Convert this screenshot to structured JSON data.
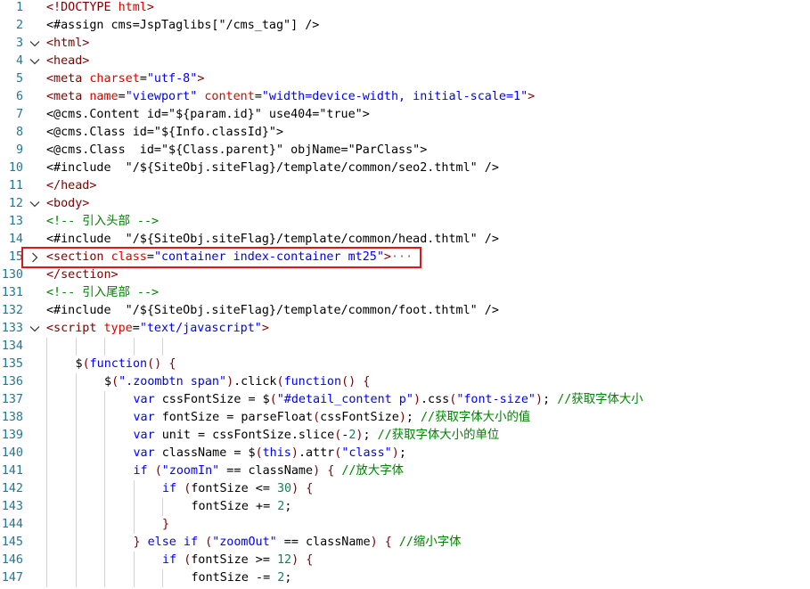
{
  "theme": {
    "line_number": "#237893",
    "tag": "#800000",
    "attr": "#e50000",
    "string": "#0000ff",
    "text": "#000000",
    "comment": "#008000",
    "keyword": "#0000ff",
    "punct": "#800000",
    "number": "#098658",
    "highlight_box": "#e0161a"
  },
  "icons": {
    "fold_open": "chevron-down-icon",
    "fold_closed": "chevron-right-icon"
  },
  "highlighted_line": "15",
  "lines": [
    {
      "num": "1",
      "fold": "",
      "indent": 0,
      "tokens": [
        [
          "tag",
          "<!DOCTYPE "
        ],
        [
          "attr",
          "html"
        ],
        [
          "tag",
          ">"
        ]
      ]
    },
    {
      "num": "2",
      "fold": "",
      "indent": 0,
      "tokens": [
        [
          "text",
          "<#assign cms=JspTaglibs[\"/cms_tag\"] />"
        ]
      ]
    },
    {
      "num": "3",
      "fold": "open",
      "indent": 0,
      "tokens": [
        [
          "tag",
          "<html>"
        ]
      ]
    },
    {
      "num": "4",
      "fold": "open",
      "indent": 0,
      "tokens": [
        [
          "tag",
          "<head>"
        ]
      ]
    },
    {
      "num": "5",
      "fold": "",
      "indent": 0,
      "tokens": [
        [
          "tag",
          "<meta "
        ],
        [
          "attr",
          "charset"
        ],
        [
          "text",
          "="
        ],
        [
          "string",
          "\"utf-8\""
        ],
        [
          "tag",
          ">"
        ]
      ]
    },
    {
      "num": "6",
      "fold": "",
      "indent": 0,
      "tokens": [
        [
          "tag",
          "<meta "
        ],
        [
          "attr",
          "name"
        ],
        [
          "text",
          "="
        ],
        [
          "string",
          "\"viewport\""
        ],
        [
          "text",
          " "
        ],
        [
          "attr",
          "content"
        ],
        [
          "text",
          "="
        ],
        [
          "string",
          "\"width=device-width, initial-scale=1\""
        ],
        [
          "tag",
          ">"
        ]
      ]
    },
    {
      "num": "7",
      "fold": "",
      "indent": 0,
      "tokens": [
        [
          "text",
          "<@cms.Content id=\"${param.id}\" use404=\"true\">"
        ]
      ]
    },
    {
      "num": "8",
      "fold": "",
      "indent": 0,
      "tokens": [
        [
          "text",
          "<@cms.Class id=\"${Info.classId}\">"
        ]
      ]
    },
    {
      "num": "9",
      "fold": "",
      "indent": 0,
      "tokens": [
        [
          "text",
          "<@cms.Class  id=\"${Class.parent}\" objName=\"ParClass\">"
        ]
      ]
    },
    {
      "num": "10",
      "fold": "",
      "indent": 0,
      "tokens": [
        [
          "text",
          "<#include  \"/${SiteObj.siteFlag}/template/common/seo2.thtml\" />"
        ]
      ]
    },
    {
      "num": "11",
      "fold": "",
      "indent": 0,
      "tokens": [
        [
          "tag",
          "</head>"
        ]
      ]
    },
    {
      "num": "12",
      "fold": "open",
      "indent": 0,
      "tokens": [
        [
          "tag",
          "<body>"
        ]
      ]
    },
    {
      "num": "13",
      "fold": "",
      "indent": 0,
      "tokens": [
        [
          "comment",
          "<!-- 引入头部 -->"
        ]
      ]
    },
    {
      "num": "14",
      "fold": "",
      "indent": 0,
      "tokens": [
        [
          "text",
          "<#include  \"/${SiteObj.siteFlag}/template/common/head.thtml\" />"
        ]
      ]
    },
    {
      "num": "15",
      "fold": "closed",
      "indent": 0,
      "tokens": [
        [
          "tag",
          "<section "
        ],
        [
          "attr",
          "class"
        ],
        [
          "text",
          "="
        ],
        [
          "string",
          "\"container index-container mt25\""
        ],
        [
          "tag",
          ">"
        ],
        [
          "ellipsis",
          "···"
        ]
      ]
    },
    {
      "num": "130",
      "fold": "",
      "indent": 0,
      "tokens": [
        [
          "tag",
          "</section>"
        ]
      ]
    },
    {
      "num": "131",
      "fold": "",
      "indent": 0,
      "tokens": [
        [
          "comment",
          "<!-- 引入尾部 -->"
        ]
      ]
    },
    {
      "num": "132",
      "fold": "",
      "indent": 0,
      "tokens": [
        [
          "text",
          "<#include  \"/${SiteObj.siteFlag}/template/common/foot.thtml\" />"
        ]
      ]
    },
    {
      "num": "133",
      "fold": "open",
      "indent": 0,
      "tokens": [
        [
          "tag",
          "<script "
        ],
        [
          "attr",
          "type"
        ],
        [
          "text",
          "="
        ],
        [
          "string",
          "\"text/javascript\""
        ],
        [
          "tag",
          ">"
        ]
      ]
    },
    {
      "num": "134",
      "fold": "",
      "indent": 0,
      "tokens": []
    },
    {
      "num": "135",
      "fold": "",
      "indent": 1,
      "tokens": [
        [
          "text",
          "$"
        ],
        [
          "punct",
          "("
        ],
        [
          "keyword",
          "function"
        ],
        [
          "punct",
          "()"
        ],
        [
          "text",
          " "
        ],
        [
          "punct",
          "{"
        ]
      ]
    },
    {
      "num": "136",
      "fold": "",
      "indent": 2,
      "tokens": [
        [
          "text",
          "$"
        ],
        [
          "punct",
          "("
        ],
        [
          "string",
          "\".zoombtn span\""
        ],
        [
          "punct",
          ")"
        ],
        [
          "text",
          ".click"
        ],
        [
          "punct",
          "("
        ],
        [
          "keyword",
          "function"
        ],
        [
          "punct",
          "()"
        ],
        [
          "text",
          " "
        ],
        [
          "punct",
          "{"
        ]
      ]
    },
    {
      "num": "137",
      "fold": "",
      "indent": 3,
      "tokens": [
        [
          "keyword",
          "var"
        ],
        [
          "text",
          " cssFontSize = $"
        ],
        [
          "punct",
          "("
        ],
        [
          "string",
          "\"#detail_content p\""
        ],
        [
          "punct",
          ")"
        ],
        [
          "text",
          ".css"
        ],
        [
          "punct",
          "("
        ],
        [
          "string",
          "\"font-size\""
        ],
        [
          "punct",
          ")"
        ],
        [
          "text",
          "; "
        ],
        [
          "comment",
          "//获取字体大小"
        ]
      ]
    },
    {
      "num": "138",
      "fold": "",
      "indent": 3,
      "tokens": [
        [
          "keyword",
          "var"
        ],
        [
          "text",
          " fontSize = parseFloat"
        ],
        [
          "punct",
          "("
        ],
        [
          "text",
          "cssFontSize"
        ],
        [
          "punct",
          ")"
        ],
        [
          "text",
          "; "
        ],
        [
          "comment",
          "//获取字体大小的值"
        ]
      ]
    },
    {
      "num": "139",
      "fold": "",
      "indent": 3,
      "tokens": [
        [
          "keyword",
          "var"
        ],
        [
          "text",
          " unit = cssFontSize.slice"
        ],
        [
          "punct",
          "("
        ],
        [
          "text",
          "-"
        ],
        [
          "number",
          "2"
        ],
        [
          "punct",
          ")"
        ],
        [
          "text",
          "; "
        ],
        [
          "comment",
          "//获取字体大小的单位"
        ]
      ]
    },
    {
      "num": "140",
      "fold": "",
      "indent": 3,
      "tokens": [
        [
          "keyword",
          "var"
        ],
        [
          "text",
          " className = $"
        ],
        [
          "punct",
          "("
        ],
        [
          "keyword",
          "this"
        ],
        [
          "punct",
          ")"
        ],
        [
          "text",
          ".attr"
        ],
        [
          "punct",
          "("
        ],
        [
          "string",
          "\"class\""
        ],
        [
          "punct",
          ")"
        ],
        [
          "text",
          ";"
        ]
      ]
    },
    {
      "num": "141",
      "fold": "",
      "indent": 3,
      "tokens": [
        [
          "keyword",
          "if"
        ],
        [
          "text",
          " "
        ],
        [
          "punct",
          "("
        ],
        [
          "string",
          "\"zoomIn\""
        ],
        [
          "text",
          " == className"
        ],
        [
          "punct",
          ")"
        ],
        [
          "text",
          " "
        ],
        [
          "punct",
          "{"
        ],
        [
          "text",
          " "
        ],
        [
          "comment",
          "//放大字体"
        ]
      ]
    },
    {
      "num": "142",
      "fold": "",
      "indent": 4,
      "tokens": [
        [
          "keyword",
          "if"
        ],
        [
          "text",
          " "
        ],
        [
          "punct",
          "("
        ],
        [
          "text",
          "fontSize <= "
        ],
        [
          "number",
          "30"
        ],
        [
          "punct",
          ")"
        ],
        [
          "text",
          " "
        ],
        [
          "punct",
          "{"
        ]
      ]
    },
    {
      "num": "143",
      "fold": "",
      "indent": 5,
      "tokens": [
        [
          "text",
          "fontSize += "
        ],
        [
          "number",
          "2"
        ],
        [
          "text",
          ";"
        ]
      ]
    },
    {
      "num": "144",
      "fold": "",
      "indent": 4,
      "tokens": [
        [
          "punct",
          "}"
        ]
      ]
    },
    {
      "num": "145",
      "fold": "",
      "indent": 3,
      "tokens": [
        [
          "punct",
          "}"
        ],
        [
          "text",
          " "
        ],
        [
          "keyword",
          "else if"
        ],
        [
          "text",
          " "
        ],
        [
          "punct",
          "("
        ],
        [
          "string",
          "\"zoomOut\""
        ],
        [
          "text",
          " == className"
        ],
        [
          "punct",
          ")"
        ],
        [
          "text",
          " "
        ],
        [
          "punct",
          "{"
        ],
        [
          "text",
          " "
        ],
        [
          "comment",
          "//缩小字体"
        ]
      ]
    },
    {
      "num": "146",
      "fold": "",
      "indent": 4,
      "tokens": [
        [
          "keyword",
          "if"
        ],
        [
          "text",
          " "
        ],
        [
          "punct",
          "("
        ],
        [
          "text",
          "fontSize >= "
        ],
        [
          "number",
          "12"
        ],
        [
          "punct",
          ")"
        ],
        [
          "text",
          " "
        ],
        [
          "punct",
          "{"
        ]
      ]
    },
    {
      "num": "147",
      "fold": "",
      "indent": 5,
      "tokens": [
        [
          "text",
          "fontSize -= "
        ],
        [
          "number",
          "2"
        ],
        [
          "text",
          ";"
        ]
      ]
    }
  ]
}
